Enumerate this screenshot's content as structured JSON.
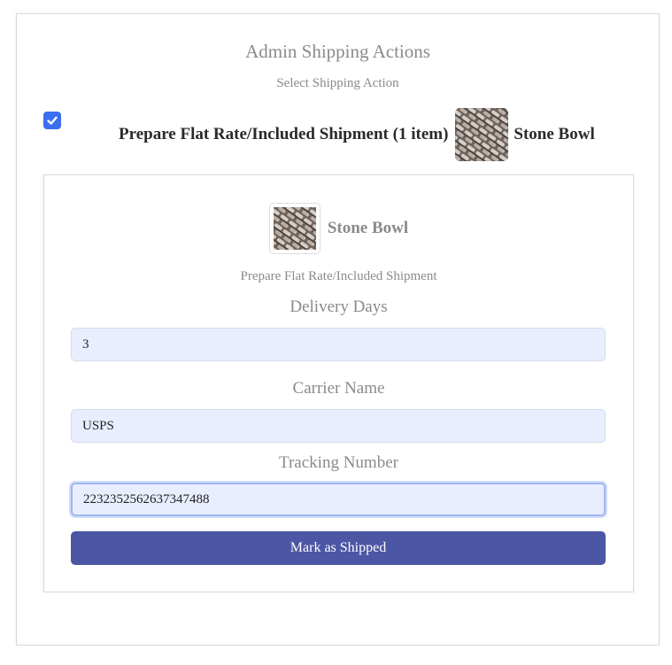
{
  "header": {
    "title": "Admin Shipping Actions",
    "subtitle": "Select Shipping Action"
  },
  "shipment": {
    "checked": true,
    "label": "Prepare Flat Rate/Included Shipment (1 item)",
    "item_name": "Stone Bowl",
    "thumbnail_icon": "stone-bowl-photo"
  },
  "panel": {
    "item_name": "Stone Bowl",
    "subtitle": "Prepare Flat Rate/Included Shipment",
    "fields": {
      "delivery_days": {
        "label": "Delivery Days",
        "value": "3"
      },
      "carrier_name": {
        "label": "Carrier Name",
        "value": "USPS"
      },
      "tracking_number": {
        "label": "Tracking Number",
        "value": "2232352562637347488"
      }
    },
    "submit_label": "Mark as Shipped"
  },
  "colors": {
    "accent": "#3b6ef0",
    "button": "#4b56a4",
    "input_bg": "#e8eefd",
    "muted_text": "#8a8a8a"
  }
}
